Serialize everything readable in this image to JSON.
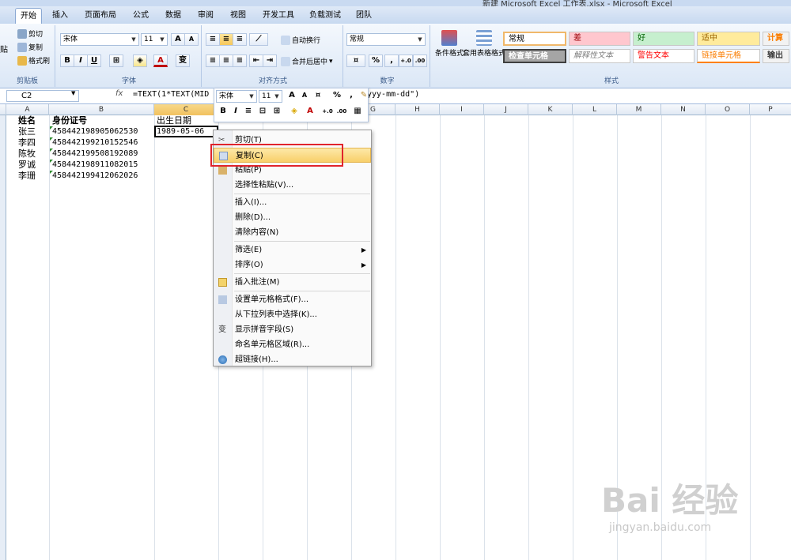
{
  "window": {
    "title": "新建 Microsoft Excel 工作表.xlsx - Microsoft Excel"
  },
  "tabs": [
    "开始",
    "插入",
    "页面布局",
    "公式",
    "数据",
    "审阅",
    "视图",
    "开发工具",
    "负载测试",
    "团队"
  ],
  "clipboard": {
    "paste": "贴",
    "cut": "剪切",
    "copy": "复制",
    "format_painter": "格式刷",
    "label": "剪贴板"
  },
  "font": {
    "name": "宋体",
    "size": "11",
    "bold": "B",
    "italic": "I",
    "underline": "U",
    "grow": "A",
    "shrink": "A",
    "color_a": "A",
    "phonetic": "变",
    "label": "字体"
  },
  "alignment": {
    "wrap": "自动换行",
    "merge": "合并后居中",
    "label": "对齐方式"
  },
  "number": {
    "format": "常规",
    "percent": "%",
    "comma": ",",
    "label": "数字"
  },
  "styles": {
    "cond": "条件格式",
    "table": "套用表格格式",
    "normal": "常规",
    "bad": "差",
    "good": "好",
    "neutral": "适中",
    "calc": "计算",
    "check": "检查单元格",
    "explain": "解释性文本",
    "warn": "警告文本",
    "linked": "链接单元格",
    "output": "输出",
    "label": "样式"
  },
  "formula_bar": {
    "cell_ref": "C2",
    "fx": "fx",
    "formula": "=TEXT(1*TEXT(MID",
    "formula_tail": "yyy-mm-dd\")"
  },
  "columns": [
    "A",
    "B",
    "C",
    "D",
    "E",
    "F",
    "G",
    "H",
    "I",
    "J",
    "K",
    "L",
    "M",
    "N",
    "O",
    "P"
  ],
  "sheet": {
    "headers": [
      "姓名",
      "身份证号",
      "出生日期"
    ],
    "rows": [
      {
        "name": "张三",
        "id": "458442198905062530",
        "date": "1989-05-06"
      },
      {
        "name": "李四",
        "id": "458442199210152546",
        "date": ""
      },
      {
        "name": "陈牧",
        "id": "458442199508192089",
        "date": ""
      },
      {
        "name": "罗诚",
        "id": "458442198911082015",
        "date": ""
      },
      {
        "name": "李珊",
        "id": "458442199412062026",
        "date": ""
      }
    ]
  },
  "mini_toolbar": {
    "font": "宋体",
    "size": "11",
    "bold": "B",
    "italic": "I",
    "pct": "%",
    "comma": ","
  },
  "context_menu": {
    "cut": "剪切(T)",
    "copy": "复制(C)",
    "paste": "粘贴(P)",
    "paste_special": "选择性粘贴(V)...",
    "insert": "插入(I)...",
    "delete": "删除(D)...",
    "clear": "清除内容(N)",
    "filter": "筛选(E)",
    "sort": "排序(O)",
    "comment": "插入批注(M)",
    "format_cells": "设置单元格格式(F)...",
    "pick_list": "从下拉列表中选择(K)...",
    "phonetic": "显示拼音字段(S)",
    "name_range": "命名单元格区域(R)...",
    "hyperlink": "超链接(H)..."
  },
  "watermark": {
    "logo": "Bai 经验",
    "url": "jingyan.baidu.com"
  }
}
